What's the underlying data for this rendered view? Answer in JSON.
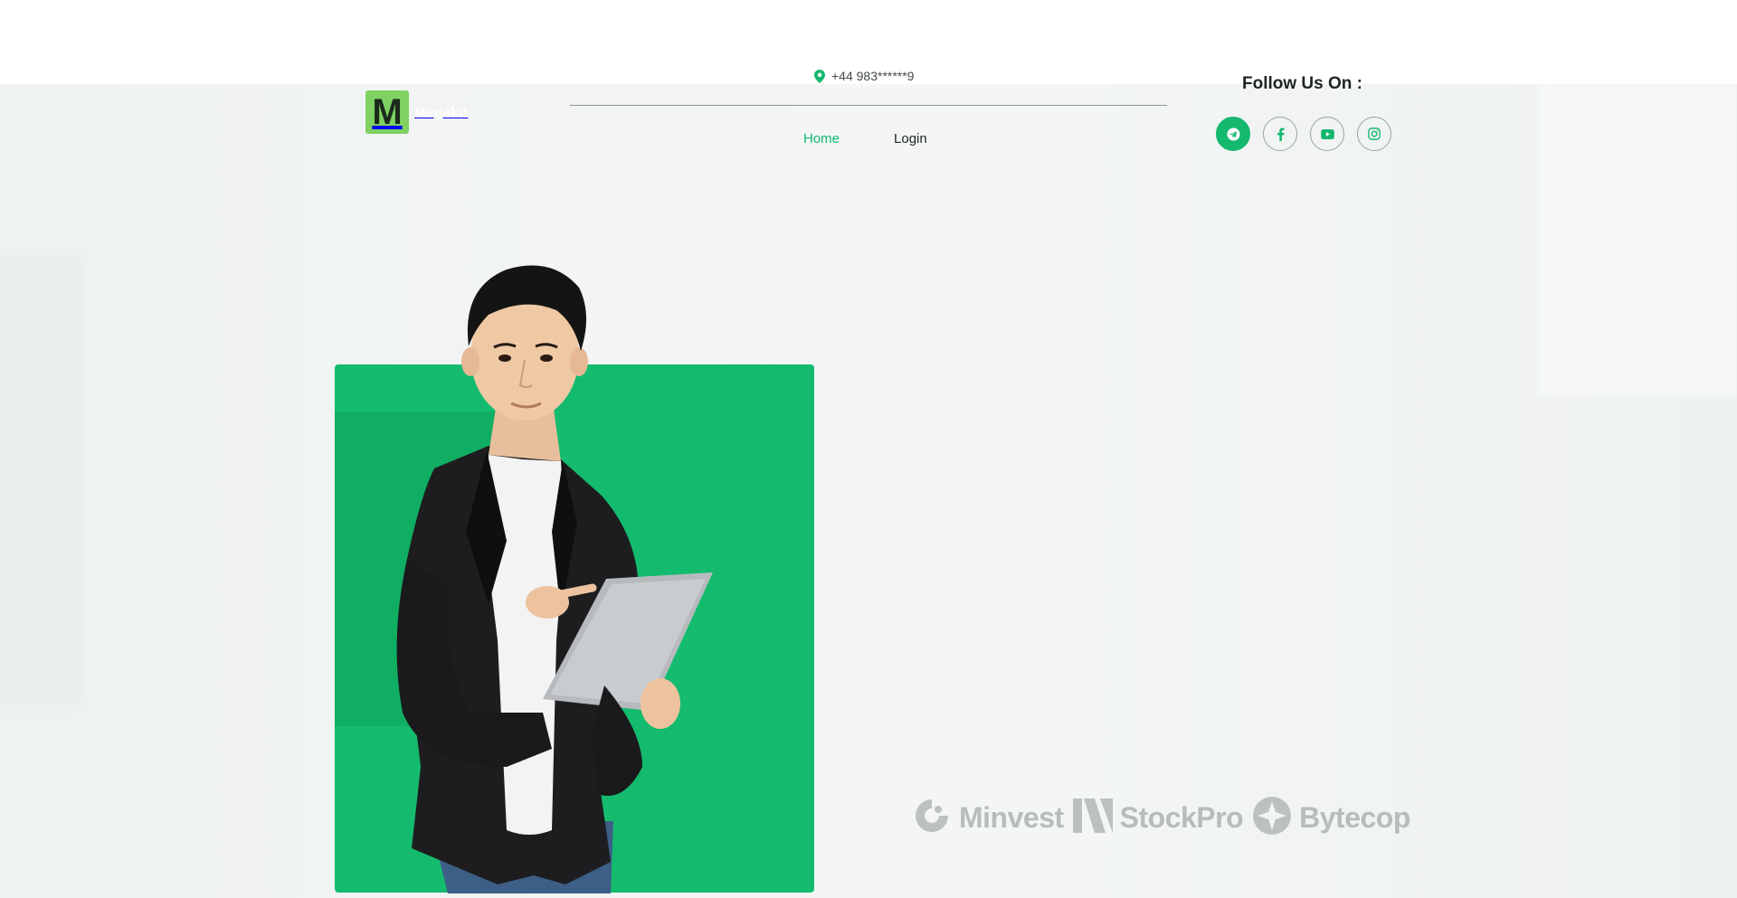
{
  "brand": {
    "logo_letter": "M",
    "logo_text": "Megakit",
    "accent": "#14b86e",
    "logo_bg": "#7fd162"
  },
  "contact": {
    "phone": "+44 983******9",
    "icon": "map-pin-icon"
  },
  "nav": {
    "items": [
      {
        "label": "Home",
        "active": true
      },
      {
        "label": "Login",
        "active": false
      }
    ]
  },
  "social": {
    "heading": "Follow Us On :",
    "icons": [
      "telegram-icon",
      "facebook-icon",
      "youtube-icon",
      "instagram-icon"
    ]
  },
  "partners": [
    {
      "name": "Minvest",
      "icon": "minvest-logo-icon"
    },
    {
      "name": "StockPro",
      "icon": "stockpro-logo-icon"
    },
    {
      "name": "Bytecop",
      "icon": "bytecop-logo-icon"
    }
  ]
}
